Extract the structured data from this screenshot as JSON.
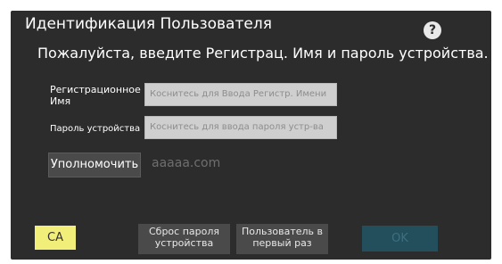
{
  "header": {
    "title": "Идентификация Пользователя",
    "help_icon": "help-icon",
    "help_glyph": "?"
  },
  "form": {
    "subtitle": "Пожалуйста, введите Регистрац. Имя и пароль устройства.",
    "registration_label": "Регистрационное Имя",
    "registration_placeholder": "Коснитесь для Ввода Регистр. Имени",
    "password_label": "Пароль устройства",
    "password_placeholder": "Коснитесь для ввода пароля устр-ва",
    "authorize_label": "Уполномочить",
    "domain_text": "aaaaa.com"
  },
  "footer": {
    "ca_label": "CA",
    "reset_password_label": "Сброс пароля устройства",
    "first_time_user_label": "Пользователь в первый раз",
    "ok_label": "OK"
  },
  "colors": {
    "panel_background": "#2c2c2c",
    "ca_button": "#f2ee7a",
    "ok_button_disabled": "#234f5d",
    "input_background": "#cfcfcf"
  }
}
